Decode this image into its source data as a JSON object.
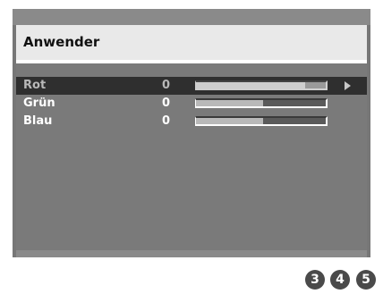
{
  "menu": {
    "title": "Anwender",
    "rows": [
      {
        "label": "Rot",
        "value": "0",
        "level": 0.84,
        "selected": true
      },
      {
        "label": "Grün",
        "value": "0",
        "level": 0.52,
        "selected": false
      },
      {
        "label": "Blau",
        "value": "0",
        "level": 0.52,
        "selected": false
      }
    ]
  },
  "steps": {
    "badges": [
      "3",
      "4",
      "5"
    ]
  },
  "icons": {
    "selection_arrow": "right-arrow-icon"
  },
  "colors": {
    "screen_bg": "#777777",
    "header_bg": "#e9e9e9",
    "selected_row_bg": "#2f2f2f",
    "badge_bg": "#4a4a4a"
  }
}
